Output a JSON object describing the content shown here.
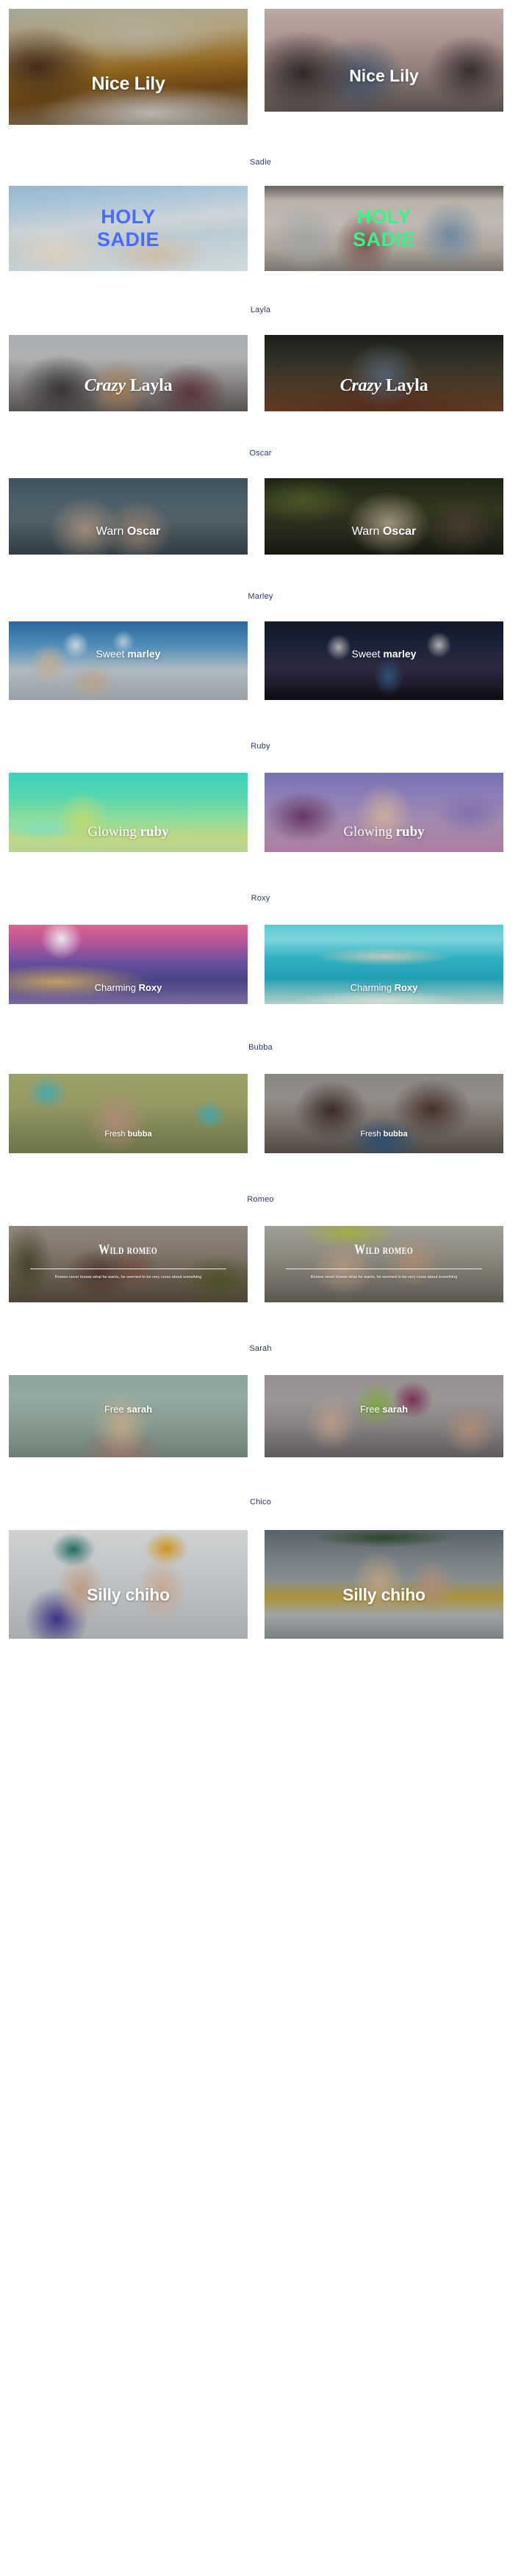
{
  "page": {
    "background": "#ffffff",
    "label_color": "#2b3a67",
    "caption_color": "#ffffff"
  },
  "sections": [
    {
      "id": "lily",
      "label": "",
      "cards": [
        {
          "caption_1": "Nice Lily",
          "caption_2": ""
        },
        {
          "caption_1": "Nice Lily",
          "caption_2": ""
        }
      ]
    },
    {
      "id": "sadie",
      "label": "Sadie",
      "cards": [
        {
          "caption_1": "HOLY",
          "caption_2": "SADIE",
          "color": "#4a6cf7"
        },
        {
          "caption_1": "HOLY",
          "caption_2": "SADIE",
          "color": "#3df08a"
        }
      ]
    },
    {
      "id": "layla",
      "label": "Layla",
      "cards": [
        {
          "caption_1": "Crazy",
          "caption_2": "Layla"
        },
        {
          "caption_1": "Crazy",
          "caption_2": "Layla"
        }
      ]
    },
    {
      "id": "oscar",
      "label": "Oscar",
      "cards": [
        {
          "caption_1": "Warn",
          "caption_2": "Oscar"
        },
        {
          "caption_1": "Warn",
          "caption_2": "Oscar"
        }
      ]
    },
    {
      "id": "marley",
      "label": "Marley",
      "cards": [
        {
          "caption_1": "Sweet",
          "caption_2": "marley"
        },
        {
          "caption_1": "Sweet",
          "caption_2": "marley"
        }
      ]
    },
    {
      "id": "ruby",
      "label": "Ruby",
      "cards": [
        {
          "caption_1": "Glowing",
          "caption_2": "ruby"
        },
        {
          "caption_1": "Glowing",
          "caption_2": "ruby"
        }
      ]
    },
    {
      "id": "roxy",
      "label": "Roxy",
      "cards": [
        {
          "caption_1": "Charming",
          "caption_2": "Roxy"
        },
        {
          "caption_1": "Charming",
          "caption_2": "Roxy"
        }
      ]
    },
    {
      "id": "bubba",
      "label": "Bubba",
      "cards": [
        {
          "caption_1": "Fresh",
          "caption_2": "bubba"
        },
        {
          "caption_1": "Fresh",
          "caption_2": "bubba"
        }
      ]
    },
    {
      "id": "romeo",
      "label": "Romeo",
      "cards": [
        {
          "caption_1": "Wild romeo",
          "description": "Romeo never knows what he wants, he seemed to be very cross about something"
        },
        {
          "caption_1": "Wild romeo",
          "description": "Romeo never knows what he wants, he seemed to be very cross about something"
        }
      ]
    },
    {
      "id": "sarah",
      "label": "Sarah",
      "cards": [
        {
          "caption_1": "Free",
          "caption_2": "sarah"
        },
        {
          "caption_1": "Free",
          "caption_2": "sarah"
        }
      ]
    },
    {
      "id": "chico",
      "label": "Chico",
      "cards": [
        {
          "caption_1": "Silly chiho",
          "caption_2": ""
        },
        {
          "caption_1": "Silly chiho",
          "caption_2": ""
        }
      ]
    }
  ]
}
